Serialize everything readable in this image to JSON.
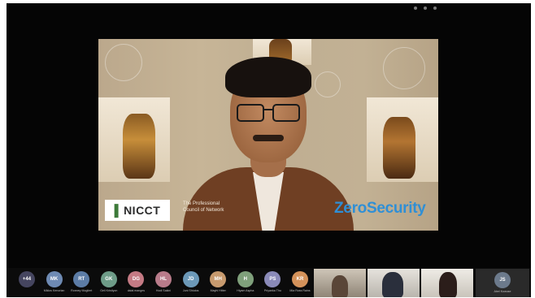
{
  "window": {
    "controls": [
      "minimize-dot",
      "maximize-dot",
      "close-dot"
    ]
  },
  "shared_screen": {
    "logo_text": "NICCT",
    "caption_lines": [
      "The Professional",
      "Council of Network"
    ],
    "brand_text": "ZeroSecurity"
  },
  "participants": [
    {
      "initials": "+44",
      "name": "",
      "color": "#45455f"
    },
    {
      "initials": "MK",
      "name": "Miklos Kenorlan",
      "color": "#6e8ab3"
    },
    {
      "initials": "RT",
      "name": "Ronney Mogliert",
      "color": "#5c7ca6"
    },
    {
      "initials": "GK",
      "name": "Geli Kristiyon",
      "color": "#6e9c88"
    },
    {
      "initials": "DG",
      "name": "dalal manges",
      "color": "#c47a84"
    },
    {
      "initials": "HL",
      "name": "Hodi Sakini",
      "color": "#b87b8a"
    },
    {
      "initials": "JD",
      "name": "Juni Shiutos",
      "color": "#6c99b8"
    },
    {
      "initials": "MH",
      "name": "Mayhi Hitter",
      "color": "#c79a6e"
    },
    {
      "initials": "H",
      "name": "Hiyam Aspha",
      "color": "#7fa07b"
    },
    {
      "initials": "PS",
      "name": "Priyanka Thu",
      "color": "#8a8ab8"
    },
    {
      "initials": "KR",
      "name": "Mia Ross Rains",
      "color": "#d4925a"
    }
  ],
  "video_tiles": [
    {
      "label": "participant-video-1"
    },
    {
      "label": "participant-video-2"
    },
    {
      "label": "participant-video-3"
    }
  ],
  "self_view": {
    "initials": "JS",
    "name": "Abel Kowuse"
  }
}
